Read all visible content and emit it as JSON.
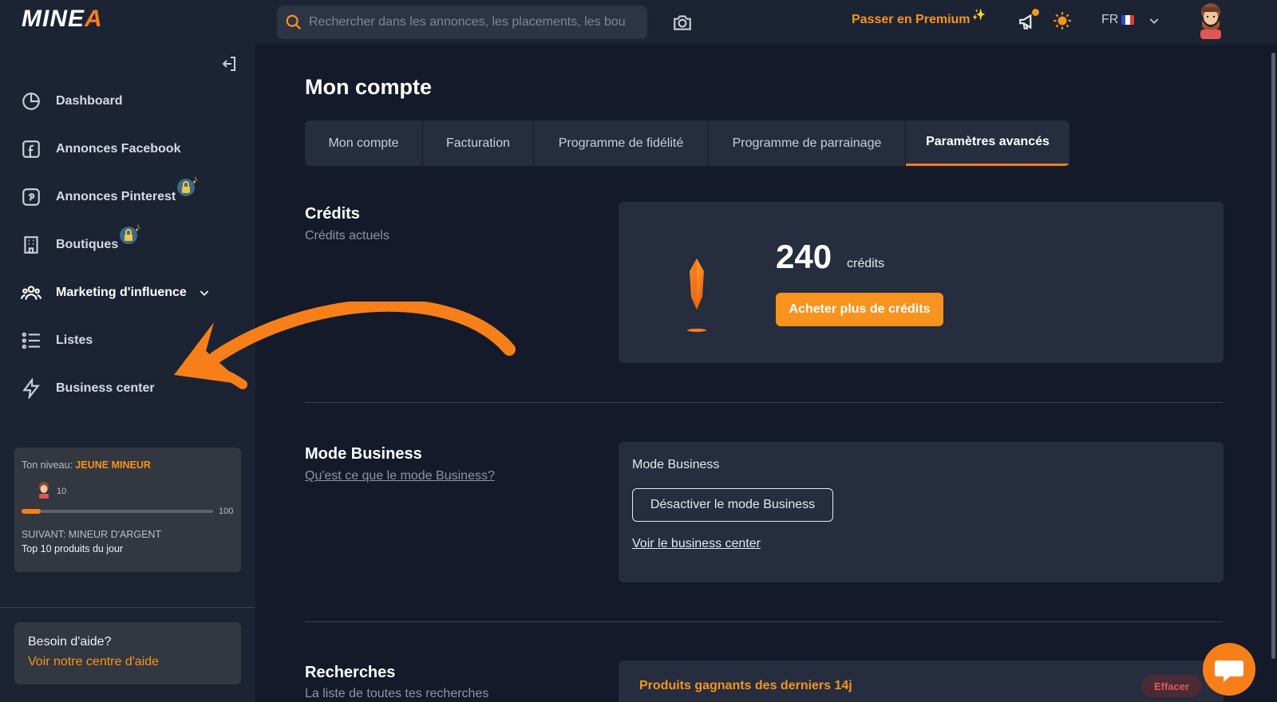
{
  "app": {
    "logo_main": "MINE",
    "logo_accent": "A"
  },
  "header": {
    "search_placeholder": "Rechercher dans les annonces, les placements, les bou",
    "premium_label": "Passer en Premium",
    "premium_spark": "✨",
    "language": "FR"
  },
  "sidebar": {
    "items": [
      {
        "label": "Dashboard",
        "icon": "pie-chart-icon"
      },
      {
        "label": "Annonces Facebook",
        "icon": "facebook-icon"
      },
      {
        "label": "Annonces Pinterest",
        "icon": "pinterest-icon",
        "locked": true
      },
      {
        "label": "Boutiques",
        "icon": "building-icon",
        "locked": true
      },
      {
        "label": "Marketing d'influence",
        "icon": "users-icon",
        "expandable": true
      },
      {
        "label": "Listes",
        "icon": "list-icon"
      },
      {
        "label": "Business center",
        "icon": "lightning-icon"
      }
    ],
    "level": {
      "prefix": "Ton niveau:",
      "rank": "JEUNE MINEUR",
      "current": "10",
      "max": "100",
      "progress": 0.1,
      "next": "SUIVANT: MINEUR D'ARGENT",
      "next_desc": "Top 10 produits du jour"
    },
    "help": {
      "title": "Besoin d'aide?",
      "link": "Voir notre centre d'aide"
    }
  },
  "main": {
    "title": "Mon compte",
    "tabs": [
      {
        "label": "Mon compte",
        "active": false
      },
      {
        "label": "Facturation",
        "active": false
      },
      {
        "label": "Programme de fidélité",
        "active": false
      },
      {
        "label": "Programme de parrainage",
        "active": false
      },
      {
        "label": "Paramètres avancés",
        "active": true
      }
    ],
    "credits": {
      "title": "Crédits",
      "subtitle": "Crédits actuels",
      "amount": "240",
      "unit": "crédits",
      "buy_label": "Acheter plus de crédits"
    },
    "business": {
      "title": "Mode Business",
      "help_link": "Qu'est ce que le mode Business?",
      "panel_label": "Mode Business",
      "deactivate_label": "Désactiver le mode Business",
      "center_link": "Voir le business center"
    },
    "searches": {
      "title": "Recherches",
      "subtitle": "La liste de toutes tes recherches",
      "first_item": "Produits gagnants des derniers 14j",
      "clear_label": "Effacer"
    }
  },
  "colors": {
    "accent": "#f77f1a",
    "background": "#141a29",
    "panel": "#252d3e",
    "sidebar": "#1c2333"
  }
}
